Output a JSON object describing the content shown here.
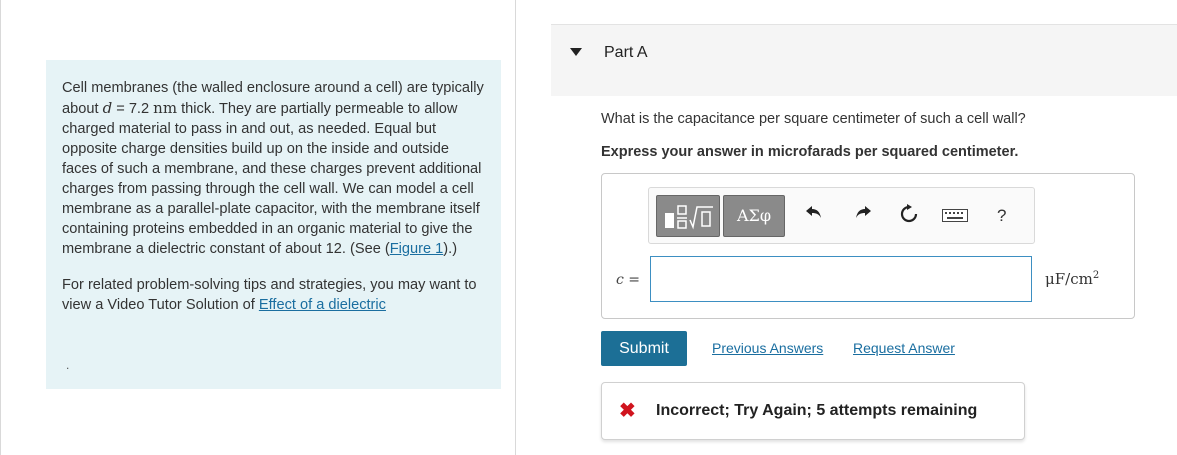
{
  "problem": {
    "p1_a": "Cell membranes (the walled enclosure around a cell) are typically about ",
    "p1_var": "d",
    "p1_eq": " = 7.2 ",
    "p1_unit": "nm",
    "p1_b": " thick. They are partially permeable to allow charged material to pass in and out, as needed. Equal but opposite charge densities build up on the inside and outside faces of such a membrane, and these charges prevent additional charges from passing through the cell wall. We can model a cell membrane as a parallel-plate capacitor, with the membrane itself containing proteins embedded in an organic material to give the membrane a dielectric constant of about 12. (See (",
    "figure_link": "Figure 1",
    "p1_c": ").)",
    "p2_a": "For related problem-solving tips and strategies, you may want to view a Video Tutor Solution of ",
    "p2_link": "Effect of a dielectric",
    "trailing": "."
  },
  "part": {
    "title": "Part A",
    "question": "What is the capacitance per square centimeter of such a cell wall?",
    "instruction": "Express your answer in microfarads per squared centimeter."
  },
  "toolbar": {
    "template_icon": "fraction-sqrt-template-icon",
    "greek_label": "ΑΣφ",
    "undo_icon": "undo-icon",
    "redo_icon": "redo-icon",
    "reset_icon": "reset-icon",
    "keyboard_icon": "keyboard-icon",
    "help_label": "?"
  },
  "answer": {
    "var_label": "c",
    "eq_label": "=",
    "value": "",
    "unit_base": "μF/cm",
    "unit_exp": "2"
  },
  "actions": {
    "submit": "Submit",
    "previous_answers": "Previous Answers",
    "request_answer": "Request Answer"
  },
  "feedback": {
    "icon": "x-mark-icon",
    "text": "Incorrect; Try Again; 5 attempts remaining",
    "color": "#d0141e"
  },
  "colors": {
    "accent": "#1c6f96",
    "link": "#1a6ea0",
    "problem_bg": "#e6f3f6"
  }
}
